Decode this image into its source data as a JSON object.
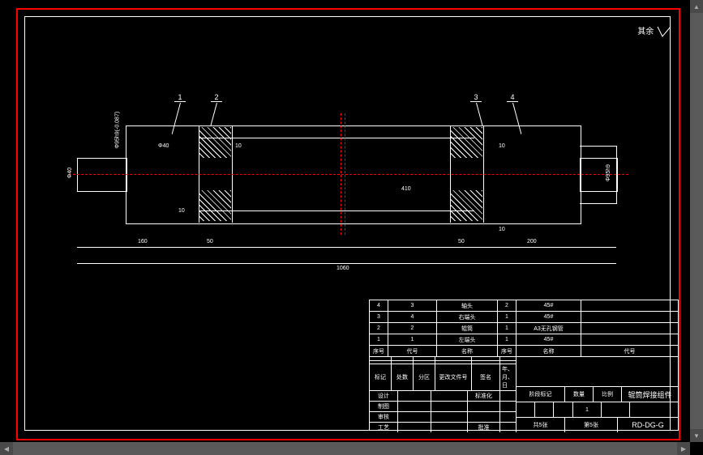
{
  "marker_text": "其余",
  "callouts": {
    "c1": "1",
    "c2": "2",
    "c3": "3",
    "c4": "4"
  },
  "dimensions": {
    "d_left_shaft": "Φ40",
    "d_body": "Φ95h9(-0.087)",
    "d_right": "Φ95h9",
    "weld_10_1": "10",
    "weld_10_2": "10",
    "weld_10_3": "10",
    "weld_10_4": "10",
    "len_160": "160",
    "len_50_l": "50",
    "len_50_r": "50",
    "len_200": "200",
    "len_total": "1060",
    "len_410": "410"
  },
  "bom": {
    "rows": [
      {
        "no": "4",
        "code": "3",
        "name": "轴头",
        "qty": "2",
        "mat": "45#",
        "note": ""
      },
      {
        "no": "3",
        "code": "4",
        "name": "右端头",
        "qty": "1",
        "mat": "45#",
        "note": ""
      },
      {
        "no": "2",
        "code": "2",
        "name": "辊筒",
        "qty": "1",
        "mat": "A3无孔钢管",
        "note": ""
      },
      {
        "no": "1",
        "code": "1",
        "name": "左端头",
        "qty": "1",
        "mat": "45#",
        "note": ""
      }
    ],
    "headers": {
      "no": "序号",
      "code": "代号",
      "name": "名称",
      "no2": "序号",
      "name2": "名称",
      "code2": "代号"
    }
  },
  "title": {
    "col_labels": {
      "biaoji": "标记",
      "chushu": "处数",
      "fenqu": "分区",
      "gengai": "更改文件号",
      "qianming": "签名",
      "nyr": "年、月、日"
    },
    "row_labels": {
      "sheji": "设计",
      "shenhe": "审核",
      "gongyi": "工艺",
      "biaozhunhua": "标准化",
      "pizhun": "批准",
      "zhitu": "制图"
    },
    "right_labels": {
      "jieduan": "阶段标记",
      "shuliang": "数量",
      "bili": "比例",
      "gong": "共5张",
      "di": "第5张"
    },
    "part_name": "辊筒焊接组件",
    "drawing_no": "RD-DG-G",
    "qty_val": "1"
  }
}
